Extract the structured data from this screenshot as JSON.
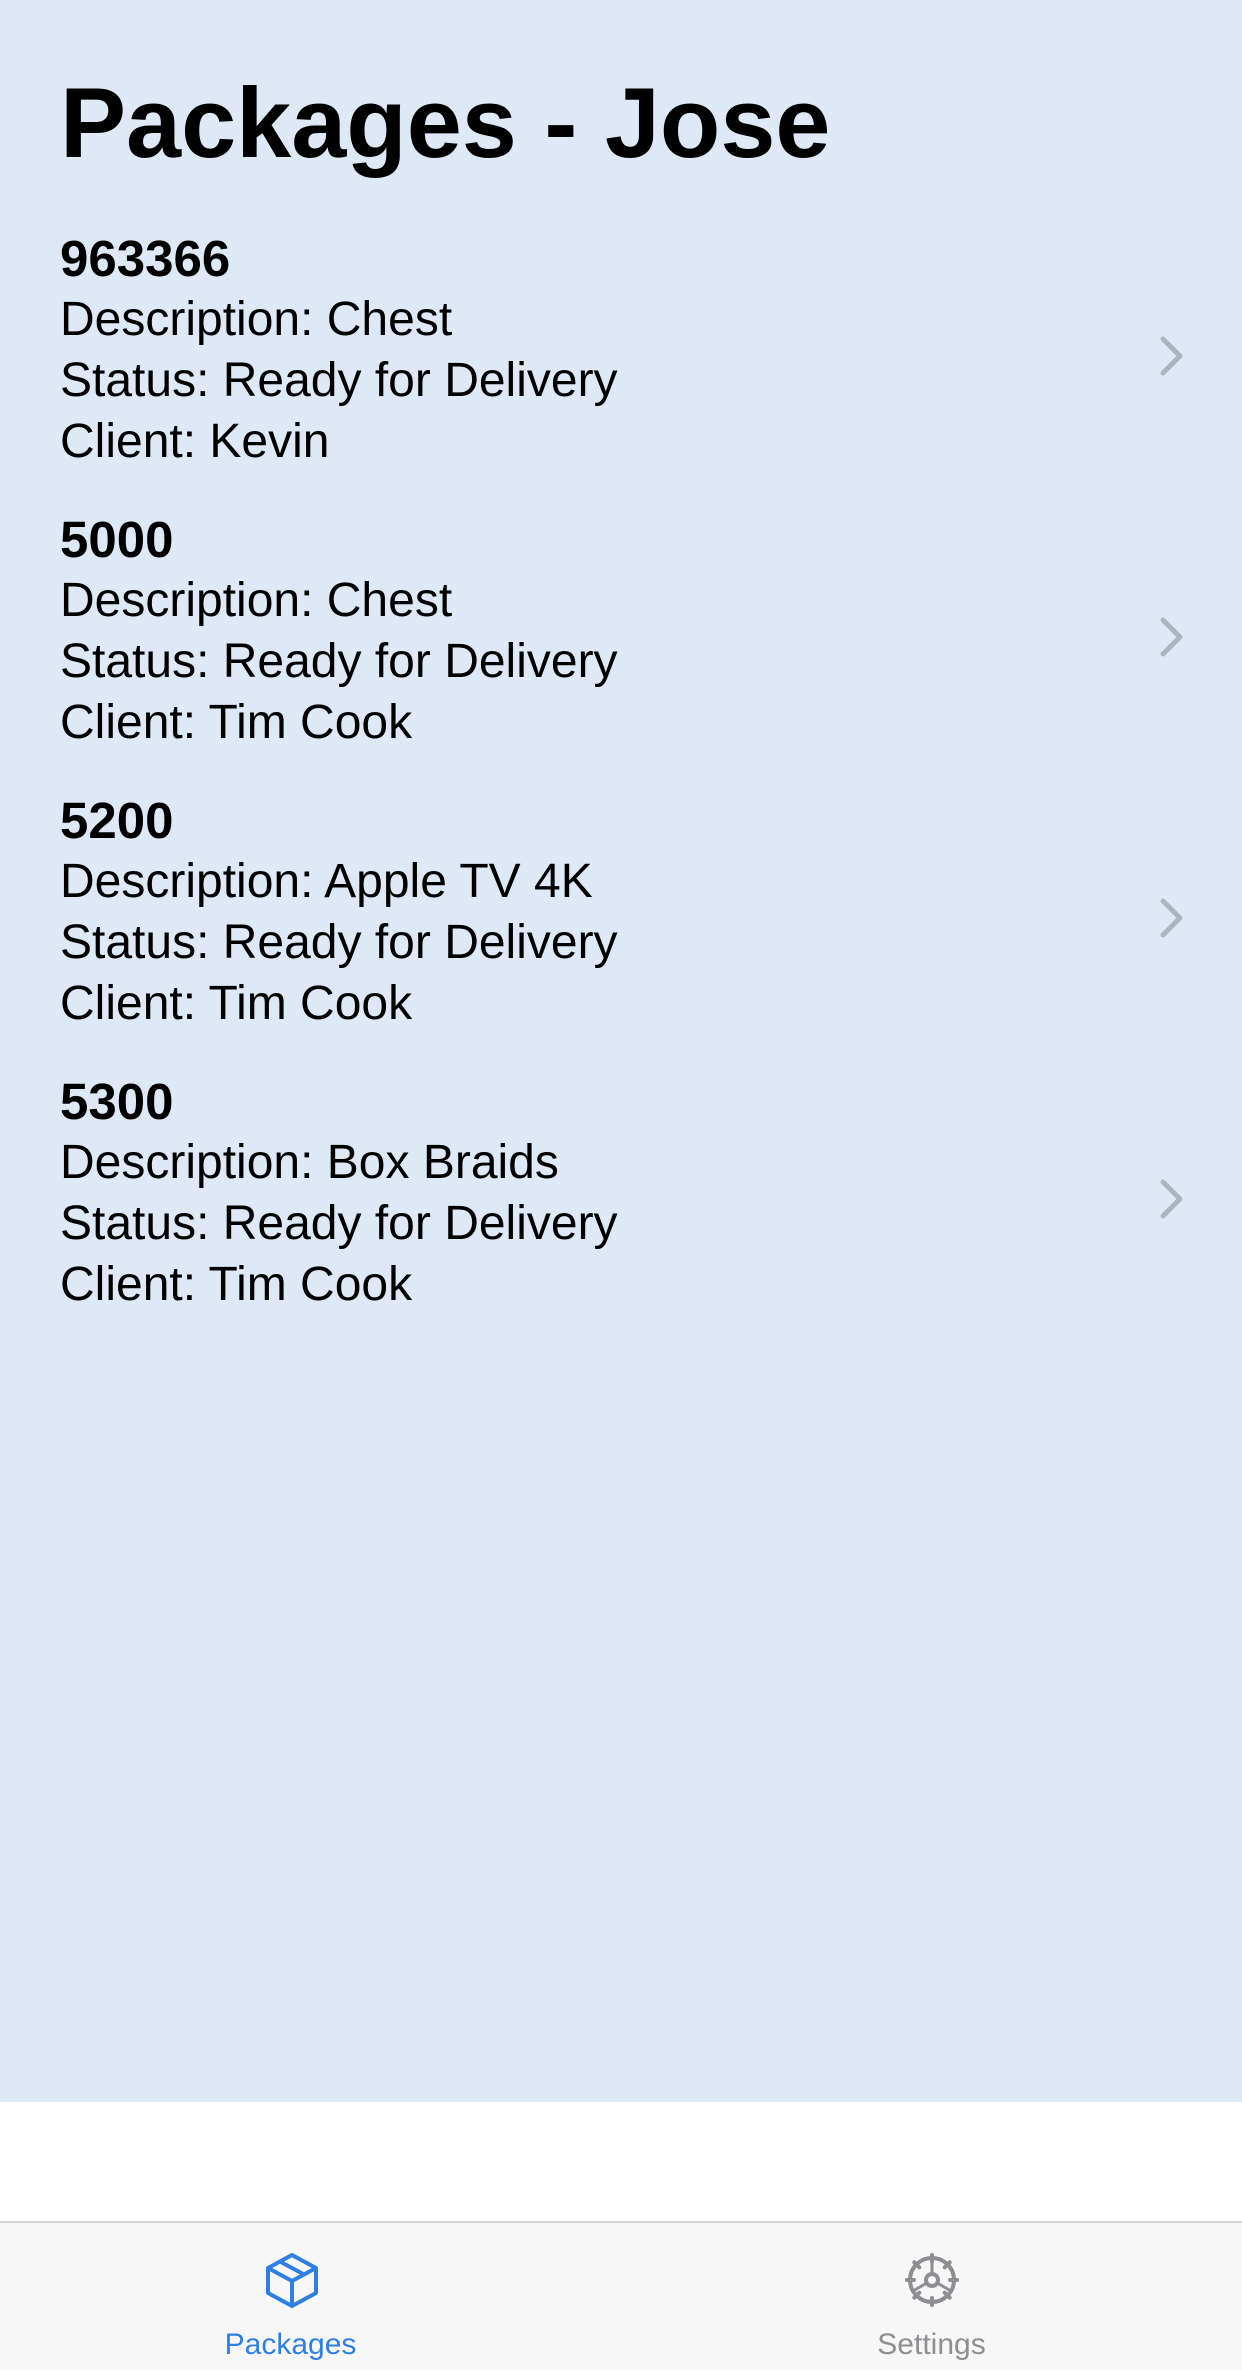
{
  "colors": {
    "background": "#dee9f5",
    "accent": "#2f7fe2",
    "inactive": "#8e8e93",
    "chevron": "#aeb4bf"
  },
  "page": {
    "title": "Packages - Jose"
  },
  "packages": [
    {
      "id": "963366",
      "description": "Description: Chest",
      "status": "Status: Ready for Delivery",
      "client": "Client: Kevin"
    },
    {
      "id": "5000",
      "description": "Description: Chest",
      "status": "Status: Ready for Delivery",
      "client": "Client: Tim Cook"
    },
    {
      "id": "5200",
      "description": "Description: Apple TV 4K",
      "status": "Status: Ready for Delivery",
      "client": "Client: Tim Cook"
    },
    {
      "id": "5300",
      "description": "Description: Box Braids",
      "status": "Status: Ready for Delivery",
      "client": "Client: Tim Cook"
    }
  ],
  "tab_bar": {
    "tabs": [
      {
        "label": "Packages",
        "icon": "package-icon",
        "active": true
      },
      {
        "label": "Settings",
        "icon": "gear-icon",
        "active": false
      }
    ]
  }
}
